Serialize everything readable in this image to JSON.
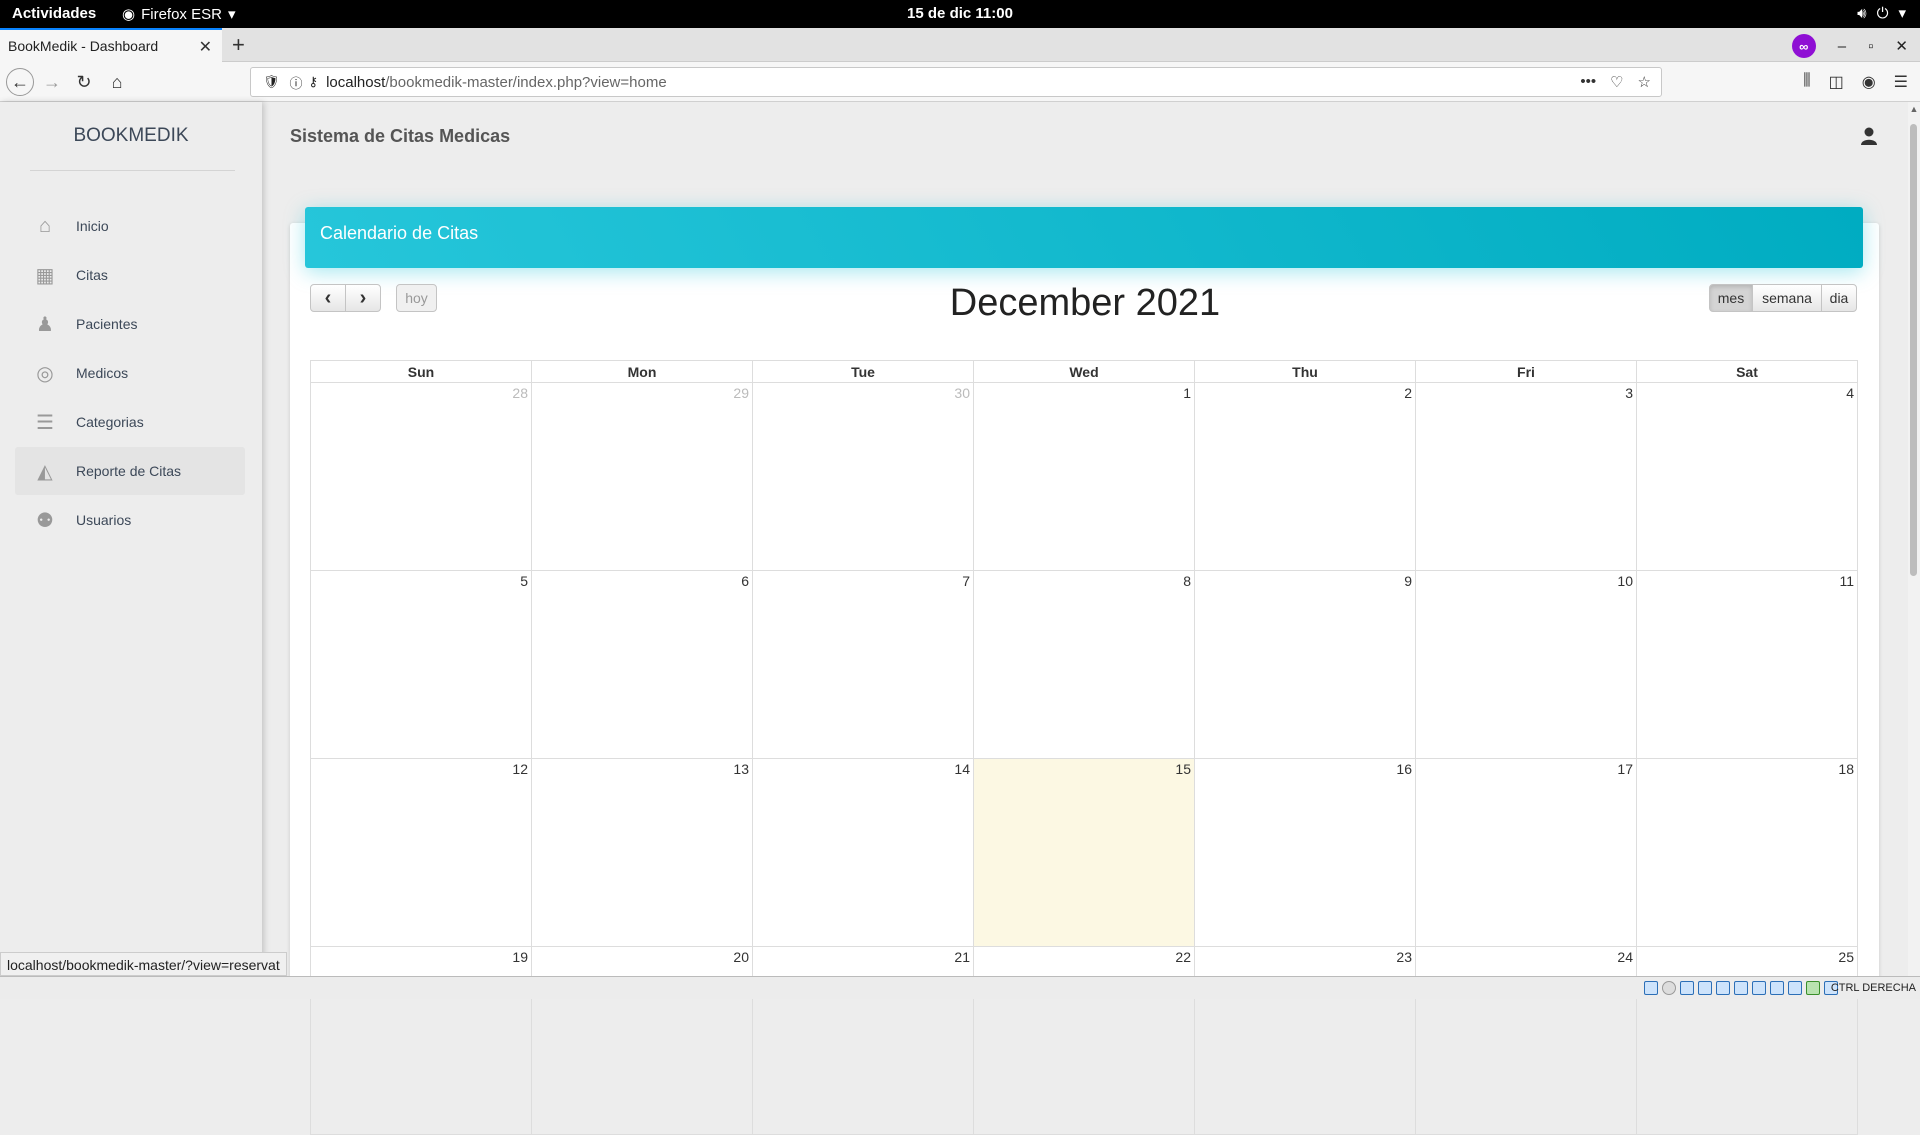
{
  "gnome": {
    "activities": "Actividades",
    "app": "Firefox ESR",
    "clock": "15 de dic  11:00"
  },
  "browser": {
    "tab_title": "BookMedik - Dashboard",
    "url_host": "localhost",
    "url_path": "/bookmedik-master/index.php?view=home",
    "status_url": "localhost/bookmedik-master/?view=reservat"
  },
  "sidebar": {
    "logo": "BOOKMEDIK",
    "items": [
      {
        "label": "Inicio",
        "icon": "home-icon"
      },
      {
        "label": "Citas",
        "icon": "calendar-icon"
      },
      {
        "label": "Pacientes",
        "icon": "person-icon"
      },
      {
        "label": "Medicos",
        "icon": "lifebuoy-icon"
      },
      {
        "label": "Categorias",
        "icon": "list-icon"
      },
      {
        "label": "Reporte de Citas",
        "icon": "area-chart-icon"
      },
      {
        "label": "Usuarios",
        "icon": "users-icon"
      }
    ]
  },
  "header": {
    "title": "Sistema de Citas Medicas"
  },
  "card": {
    "title": "Calendario de Citas"
  },
  "calendar": {
    "prev": "‹",
    "next": "›",
    "today_btn": "hoy",
    "title": "December 2021",
    "views": [
      "mes",
      "semana",
      "dia"
    ],
    "active_view": "mes",
    "days": [
      "Sun",
      "Mon",
      "Tue",
      "Wed",
      "Thu",
      "Fri",
      "Sat"
    ],
    "weeks": [
      [
        "28",
        "29",
        "30",
        "1",
        "2",
        "3",
        "4"
      ],
      [
        "5",
        "6",
        "7",
        "8",
        "9",
        "10",
        "11"
      ],
      [
        "12",
        "13",
        "14",
        "15",
        "16",
        "17",
        "18"
      ],
      [
        "19",
        "20",
        "21",
        "22",
        "23",
        "24",
        "25"
      ]
    ],
    "today": "15"
  },
  "vbox": {
    "host_key": "CTRL DERECHA"
  },
  "colors": {
    "card_header": "#00bcd4",
    "today_cell": "#fcf8e3"
  }
}
